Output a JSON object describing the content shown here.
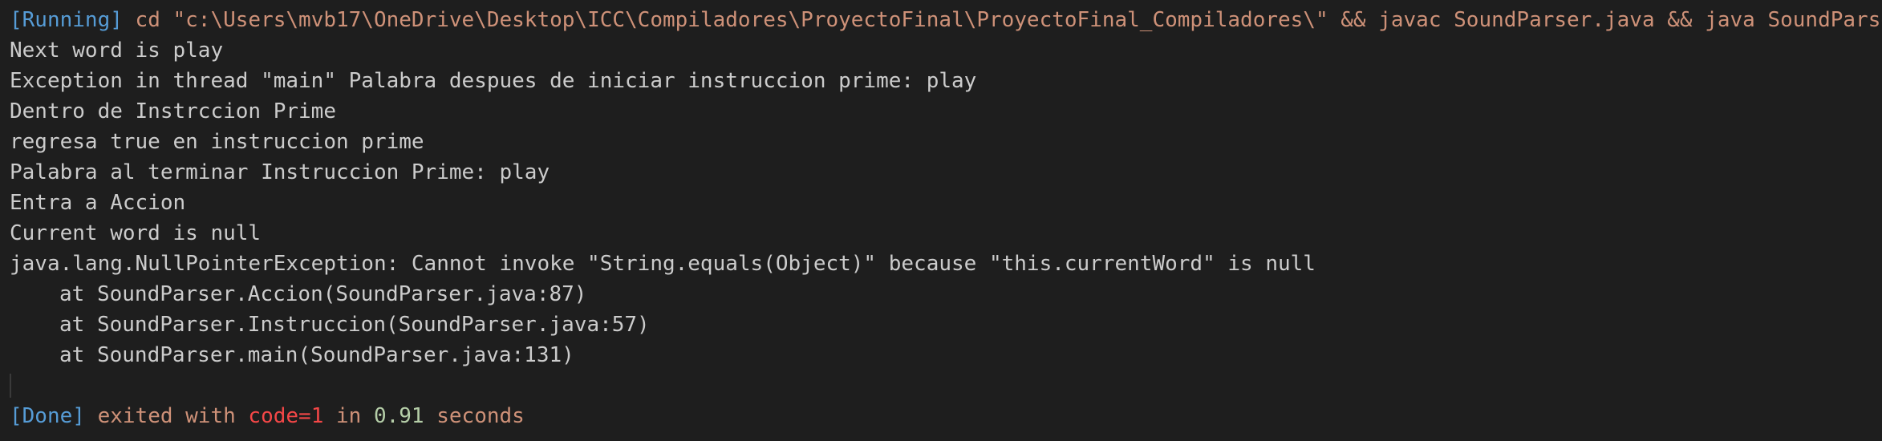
{
  "header": {
    "running_tag": "[Running]",
    "command": " cd \"c:\\Users\\mvb17\\OneDrive\\Desktop\\ICC\\Compiladores\\ProyectoFinal\\ProyectoFinal_Compiladores\\\" && javac SoundParser.java && java SoundParser"
  },
  "output_lines": [
    "Next word is play",
    "Exception in thread \"main\" Palabra despues de iniciar instruccion prime: play",
    "Dentro de Instrccion Prime",
    "regresa true en instruccion prime",
    "Palabra al terminar Instruccion Prime: play",
    "Entra a Accion",
    "Current word is null",
    "java.lang.NullPointerException: Cannot invoke \"String.equals(Object)\" because \"this.currentWord\" is null"
  ],
  "stack_trace": [
    "at SoundParser.Accion(SoundParser.java:87)",
    "at SoundParser.Instruccion(SoundParser.java:57)",
    "at SoundParser.main(SoundParser.java:131)"
  ],
  "footer": {
    "done_tag": "[Done]",
    "exit_text": " exited with ",
    "code_text": "code=1",
    "in_text": " in ",
    "duration": "0.91",
    "seconds_text": " seconds"
  },
  "colors": {
    "background": "#1e1e1e",
    "foreground": "#cccccc",
    "tag_blue": "#569cd6",
    "string_orange": "#ce9178",
    "error_red": "#f44747",
    "number_green": "#b5cea8"
  }
}
